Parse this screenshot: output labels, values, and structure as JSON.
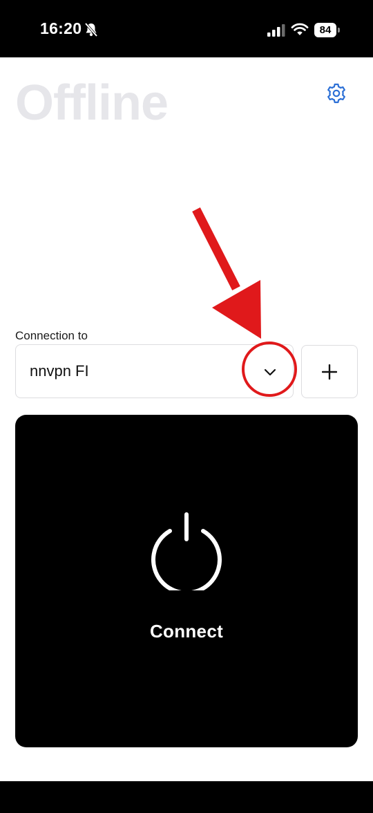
{
  "status_bar": {
    "time": "16:20",
    "bell_icon": "bell-slash-icon",
    "signal_icon": "cellular-signal-icon",
    "wifi_icon": "wifi-icon",
    "battery_level": "84"
  },
  "header": {
    "title": "Offline",
    "settings_icon": "gear-icon"
  },
  "connection": {
    "label": "Connection to",
    "selected_value": "nnvpn FI",
    "dropdown_icon": "chevron-down-icon",
    "add_icon": "plus-icon"
  },
  "connect_card": {
    "power_icon": "power-icon",
    "label": "Connect"
  },
  "annotation": {
    "color": "#e0191b",
    "arrow_icon": "arrow-down-icon",
    "circle": "highlight-circle"
  },
  "colors": {
    "accent": "#2b6fd6",
    "title_muted": "#e6e6ea",
    "card_bg": "#000000",
    "border": "#dcdcdf"
  }
}
